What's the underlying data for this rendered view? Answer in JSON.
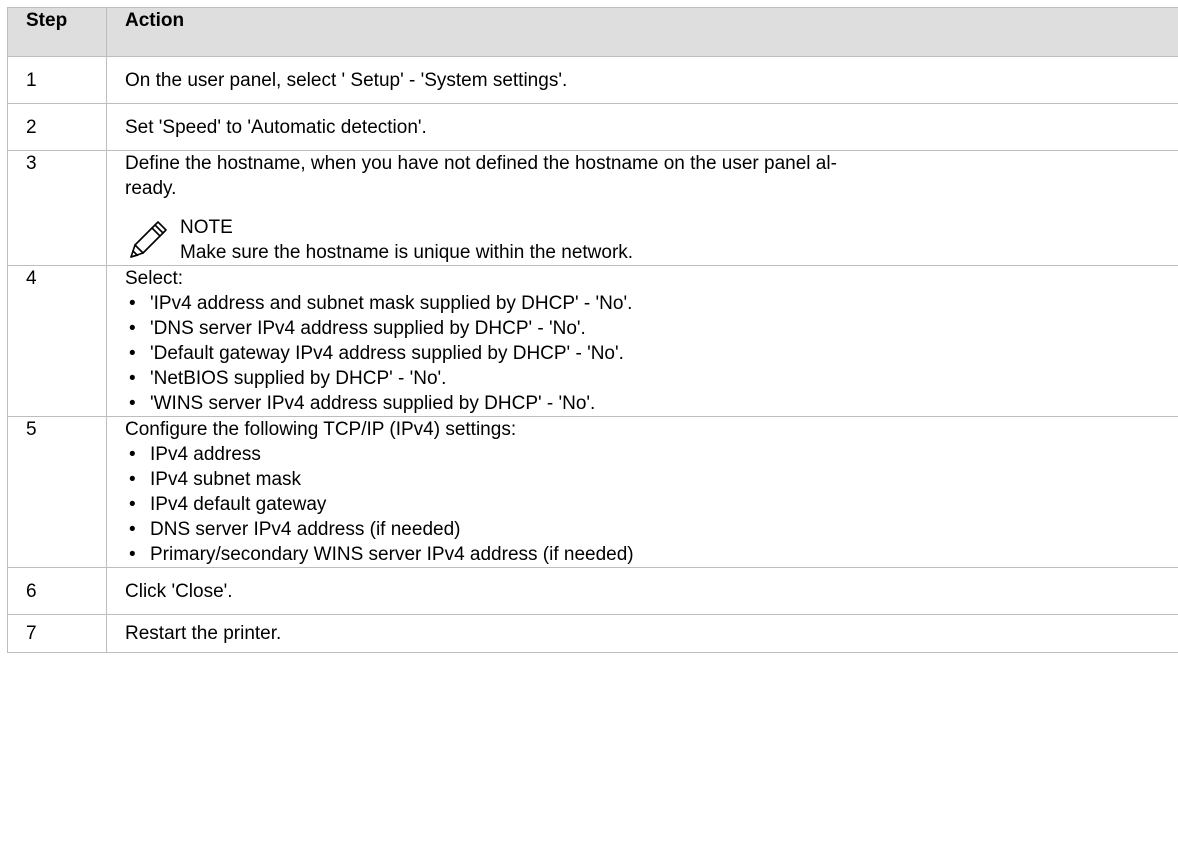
{
  "table": {
    "header": {
      "step": "Step",
      "action": "Action"
    },
    "rows": [
      {
        "step": "1",
        "action": "On the user panel, select ' Setup' - 'System settings'."
      },
      {
        "step": "2",
        "action": "Set 'Speed' to 'Automatic detection'."
      },
      {
        "step": "3",
        "action_line1": "Define the hostname, when you have not defined the hostname on the user panel al-",
        "action_line2": "ready.",
        "note": {
          "icon": "pencil-icon",
          "title": "NOTE",
          "text": "Make sure the hostname is unique within the network."
        }
      },
      {
        "step": "4",
        "intro": "Select:",
        "bullets": [
          "'IPv4 address and subnet mask supplied by DHCP' - 'No'.",
          "'DNS server IPv4 address supplied by DHCP' - 'No'.",
          "'Default gateway IPv4 address supplied by DHCP' - 'No'.",
          "'NetBIOS supplied by DHCP' - 'No'.",
          "'WINS server IPv4 address supplied by DHCP' - 'No'."
        ]
      },
      {
        "step": "5",
        "intro": "Configure the following TCP/IP (IPv4) settings:",
        "bullets": [
          "IPv4 address",
          "IPv4 subnet mask",
          "IPv4 default gateway",
          "DNS server IPv4 address (if needed)",
          "Primary/secondary WINS server IPv4 address (if needed)"
        ]
      },
      {
        "step": "6",
        "action": "Click 'Close'."
      },
      {
        "step": "7",
        "action": "Restart the printer."
      }
    ],
    "bullet_glyph": "•"
  },
  "colors": {
    "header_bg": "#dedede",
    "border": "#bdbdbd",
    "text": "#000000"
  }
}
